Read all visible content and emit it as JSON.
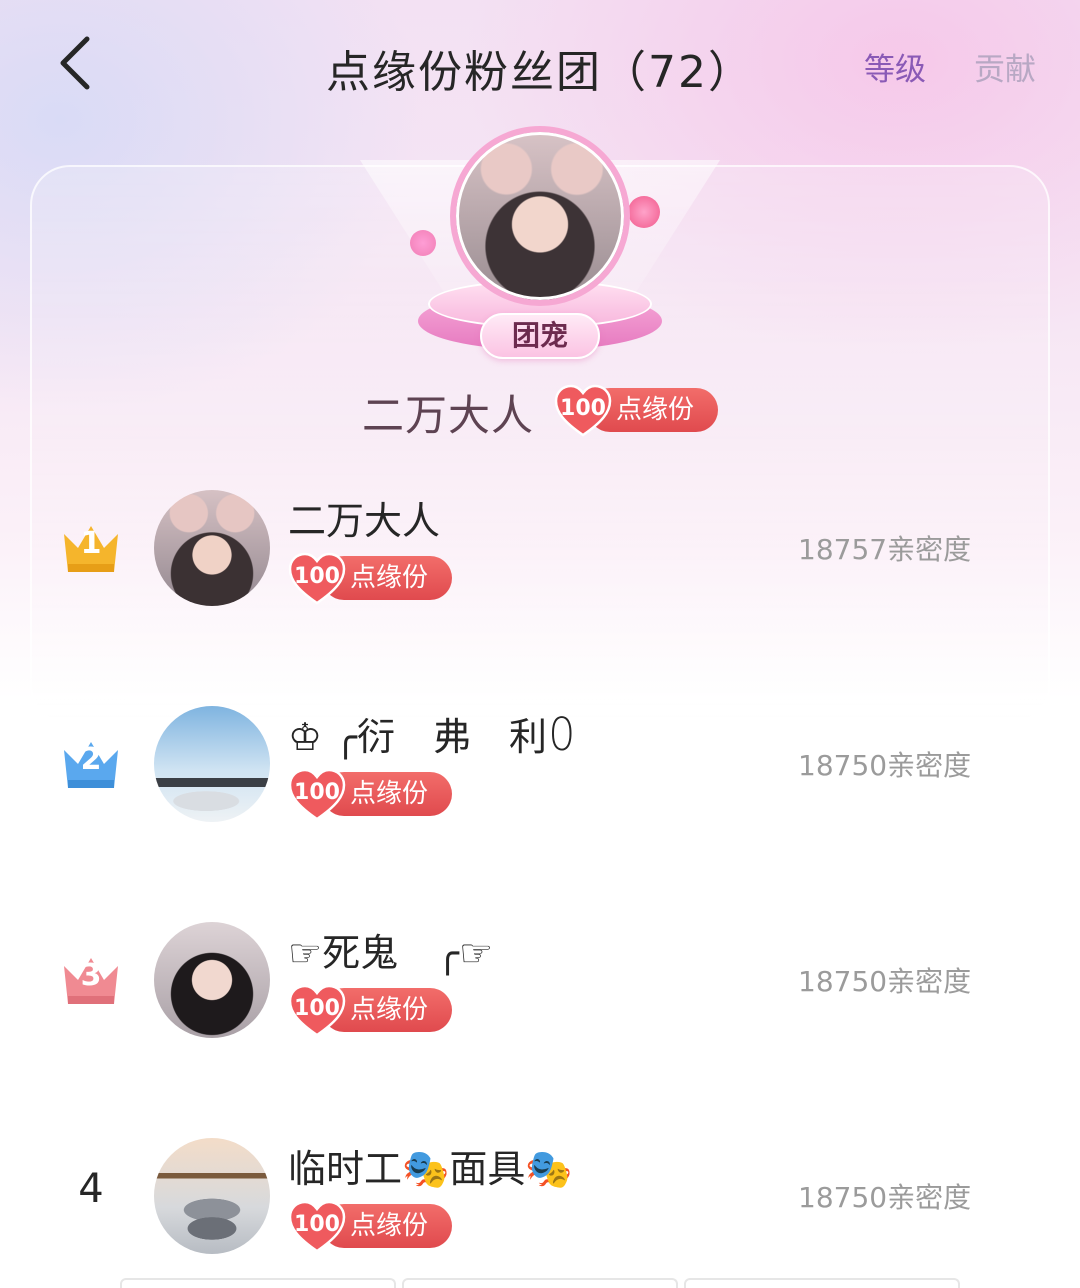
{
  "header": {
    "title": "点缘份粉丝团（72）",
    "tab_level": "等级",
    "tab_contribution": "贡献",
    "back_icon": "chevron-left-icon"
  },
  "hero": {
    "pet_label": "团宠",
    "name": "二万大人",
    "badge_level": "100",
    "badge_text": "点缘份"
  },
  "ranking": [
    {
      "rank": "1",
      "rank_style": "crown-gold",
      "name": "二万大人",
      "badge_level": "100",
      "badge_text": "点缘份",
      "score": "18757亲密度"
    },
    {
      "rank": "2",
      "rank_style": "crown-blue",
      "name": "♔ ╭衍　弗　利ꄲ",
      "badge_level": "100",
      "badge_text": "点缘份",
      "score": "18750亲密度"
    },
    {
      "rank": "3",
      "rank_style": "crown-pink",
      "name": "☞死鬼　╭☞",
      "badge_level": "100",
      "badge_text": "点缘份",
      "score": "18750亲密度"
    },
    {
      "rank": "4",
      "rank_style": "number",
      "name": "临时工🎭面具🎭",
      "badge_level": "100",
      "badge_text": "点缘份",
      "score": "18750亲密度"
    }
  ],
  "colors": {
    "crown_gold": "#f5b52c",
    "crown_blue": "#5aa8ee",
    "crown_pink": "#f08a92",
    "badge_red": "#e5524f",
    "tab_active": "#8a5ab6",
    "tab_inactive": "#b8a8c4"
  }
}
